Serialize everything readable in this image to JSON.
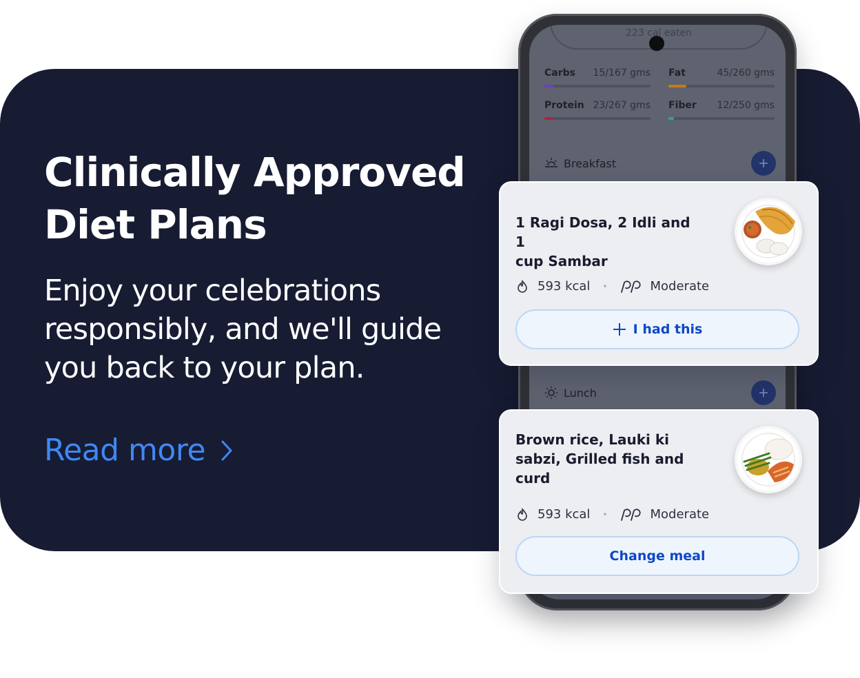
{
  "hero": {
    "headline_line1": "Clinically Approved",
    "headline_line2": "Diet Plans",
    "subtext_line1": "Enjoy your celebrations",
    "subtext_line2": "responsibly, and we'll guide",
    "subtext_line3": "you back to your plan.",
    "read_more_label": "Read more",
    "read_more_icon": "chevron-right-icon"
  },
  "phone": {
    "calories_label": "223 cal eaten",
    "macros": [
      {
        "name": "Carbs",
        "value": "15/167 gms",
        "progress": 0.09,
        "color": "#6a3fc4"
      },
      {
        "name": "Fat",
        "value": "45/260 gms",
        "progress": 0.17,
        "color": "#c97a15"
      },
      {
        "name": "Protein",
        "value": "23/267 gms",
        "progress": 0.09,
        "color": "#b8203e"
      },
      {
        "name": "Fiber",
        "value": "12/250 gms",
        "progress": 0.05,
        "color": "#23a8a2"
      }
    ],
    "meals": [
      {
        "label": "Breakfast",
        "icon": "sunrise-icon"
      },
      {
        "label": "Lunch",
        "icon": "sun-icon"
      }
    ]
  },
  "cards": [
    {
      "title_line1": "1 Ragi Dosa, 2 Idli and 1",
      "title_line2": "cup Sambar",
      "kcal": "593 kcal",
      "level": "Moderate",
      "button_label": "I had this",
      "button_icon": "plus-icon",
      "image": "dosa-idli-plate"
    },
    {
      "title_line1": "Brown rice, Lauki ki",
      "title_line2": "sabzi, Grilled fish and",
      "title_line3": "curd",
      "kcal": "593 kcal",
      "level": "Moderate",
      "button_label": "Change meal",
      "image": "rice-fish-plate"
    }
  ],
  "colors": {
    "banner_bg": "#171c33",
    "accent_link": "#3f88f5",
    "button_text": "#0d47c8"
  }
}
